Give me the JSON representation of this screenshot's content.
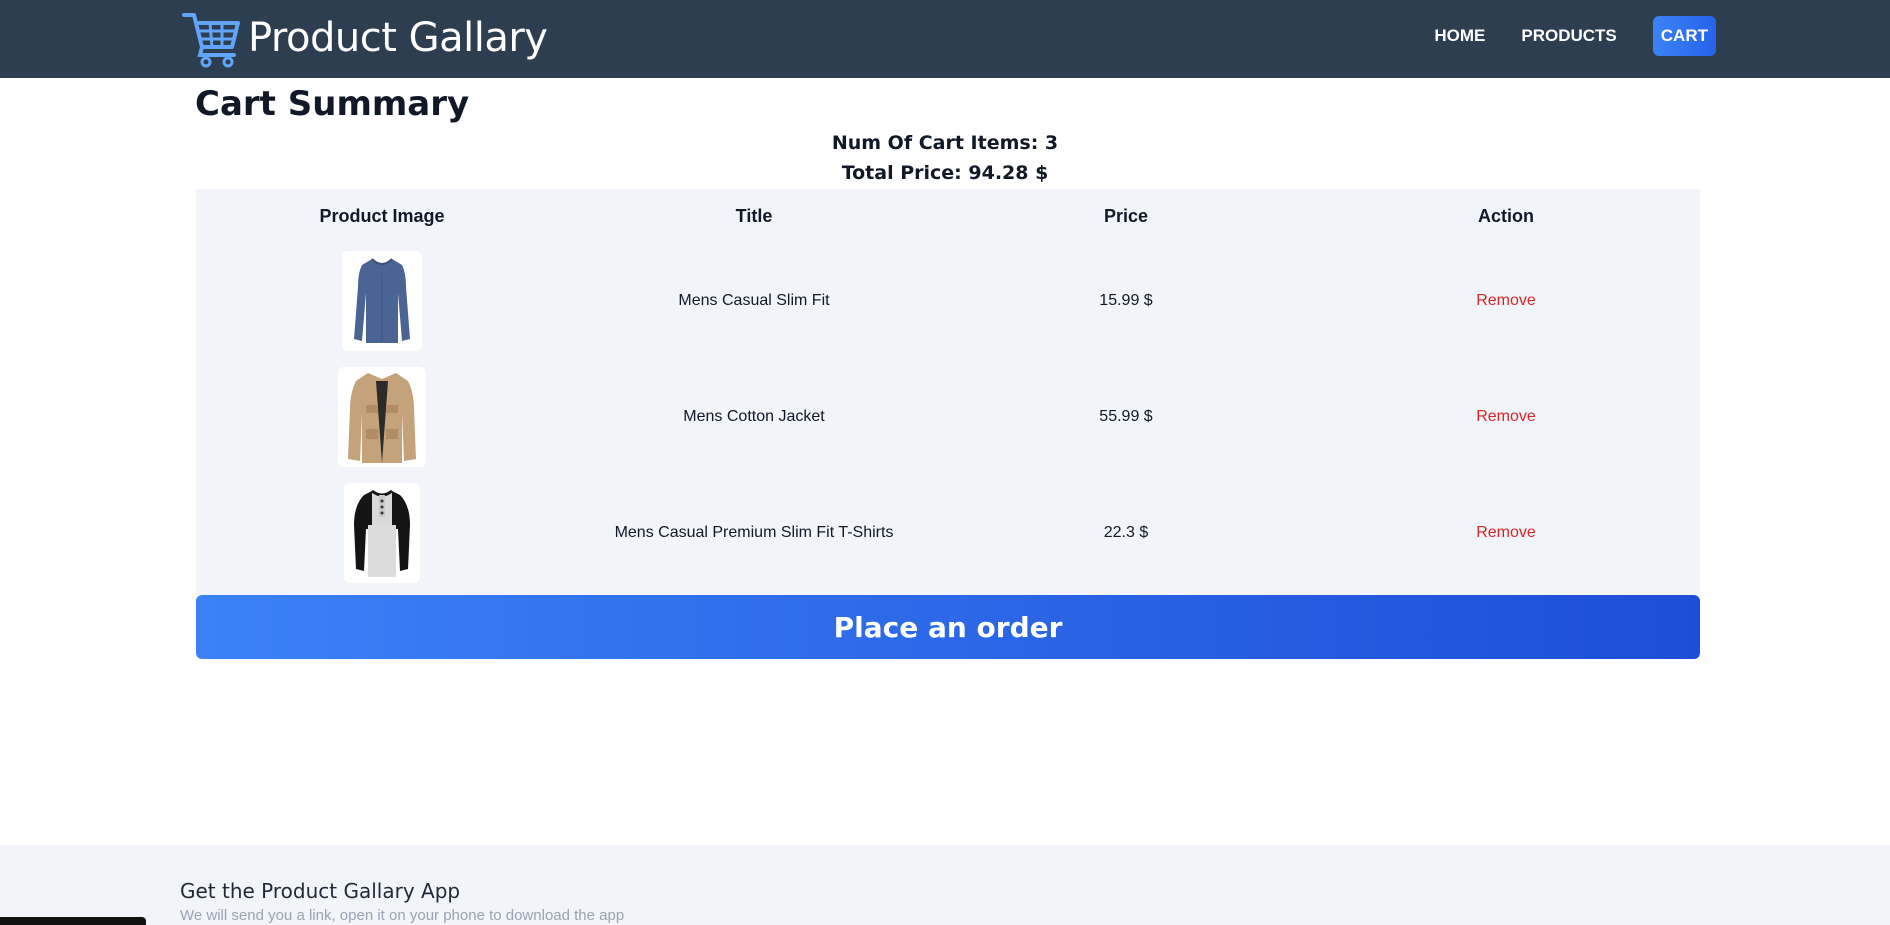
{
  "header": {
    "brand_title": "Product Gallary",
    "nav": [
      {
        "label": "HOME",
        "active": false
      },
      {
        "label": "PRODUCTS",
        "active": false
      },
      {
        "label": "CART",
        "active": true
      }
    ]
  },
  "cart": {
    "title": "Cart Summary",
    "num_items_text": "Num Of Cart Items: 3",
    "total_price_text": "Total Price: 94.28 $",
    "columns": [
      "Product Image",
      "Title",
      "Price",
      "Action"
    ],
    "items": [
      {
        "title": "Mens Casual Slim Fit",
        "price": "15.99 $",
        "action": "Remove",
        "image": "blue-long-sleeve-shirt"
      },
      {
        "title": "Mens Cotton Jacket",
        "price": "55.99 $",
        "action": "Remove",
        "image": "tan-cotton-jacket"
      },
      {
        "title": "Mens Casual Premium Slim Fit T-Shirts",
        "price": "22.3 $",
        "action": "Remove",
        "image": "raglan-henley-shirt"
      }
    ],
    "order_button": "Place an order"
  },
  "footer": {
    "title": "Get the Product Gallary App",
    "subtitle": "We will send you a link, open it on your phone to download the app"
  },
  "colors": {
    "header_bg": "#2d3e51",
    "accent": "#2563eb",
    "table_bg": "#f1f4f9",
    "remove": "#dc2626",
    "cart_icon": "#60a5fa"
  }
}
